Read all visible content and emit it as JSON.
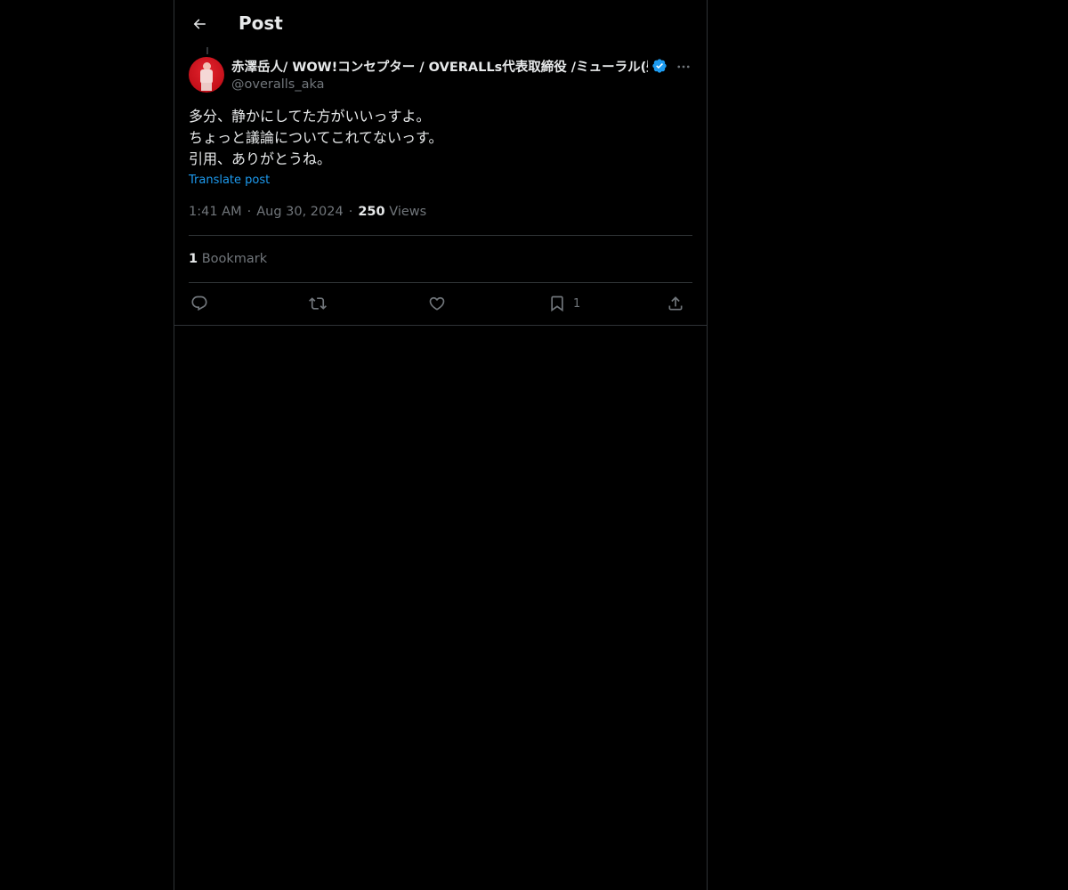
{
  "header": {
    "title": "Post"
  },
  "post": {
    "display_name": "赤澤岳人/ WOW!コンセプター / OVERALLs代表取締役 /ミューラル(壁",
    "handle": "@overalls_aka",
    "verified": true,
    "text_lines": [
      "多分、静かにしてた方がいいっすよ。",
      "ちょっと議論についてこれてないっす。",
      "引用、ありがとうね。"
    ],
    "translate_label": "Translate post",
    "time": "1:41 AM",
    "date": "Aug 30, 2024",
    "separator": "·",
    "views_count": "250",
    "views_label": "Views",
    "bookmark_count": "1",
    "bookmark_label": "Bookmark"
  },
  "actions": {
    "reply_icon": "reply-icon",
    "repost_icon": "repost-icon",
    "like_icon": "heart-icon",
    "bookmark_icon": "bookmark-icon",
    "bookmark_count": "1",
    "share_icon": "share-icon"
  },
  "colors": {
    "background": "#000000",
    "text_primary": "#e7e9ea",
    "text_secondary": "#71767b",
    "accent": "#1d9bf0",
    "border": "#2f3336",
    "avatar_bg": "#d2161f"
  }
}
